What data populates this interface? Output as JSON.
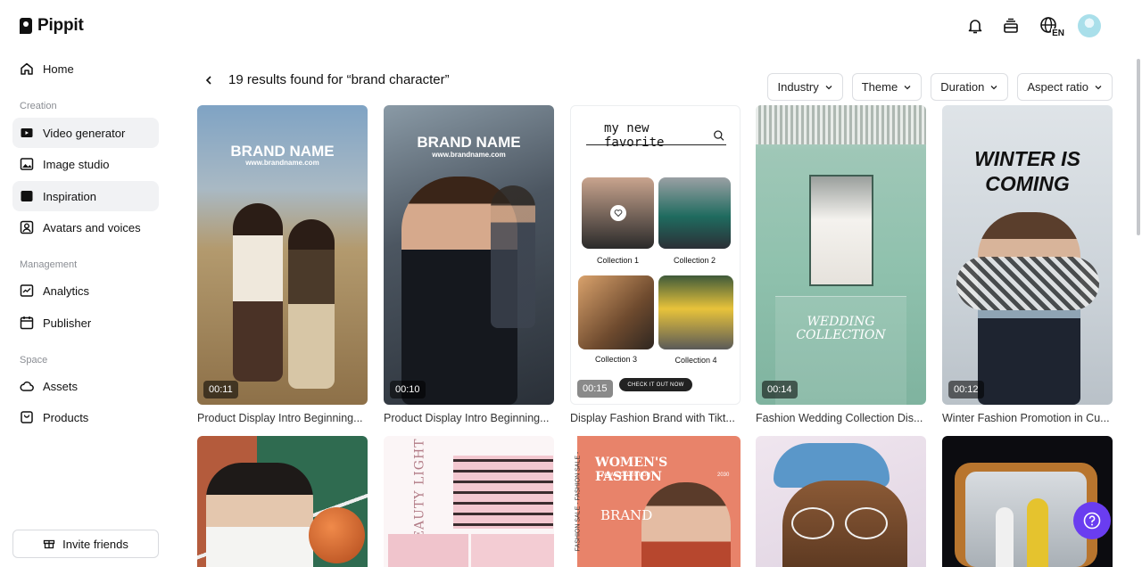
{
  "app": {
    "name": "Pippit"
  },
  "sidebar": {
    "home": "Home",
    "sections": {
      "creation": "Creation",
      "management": "Management",
      "space": "Space"
    },
    "items": {
      "video_generator": "Video generator",
      "image_studio": "Image studio",
      "inspiration": "Inspiration",
      "avatars": "Avatars and voices",
      "analytics": "Analytics",
      "publisher": "Publisher",
      "assets": "Assets",
      "products": "Products"
    },
    "invite": "Invite friends"
  },
  "header": {
    "language": "EN"
  },
  "results": {
    "title": "19 results found for “brand character”"
  },
  "filters": [
    "Industry",
    "Theme",
    "Duration",
    "Aspect ratio"
  ],
  "cards": [
    {
      "duration": "00:11",
      "caption": "Product Display Intro Beginning...",
      "overlay": "BRAND NAME",
      "sub": "www.brandname.com"
    },
    {
      "duration": "00:10",
      "caption": "Product Display Intro Beginning...",
      "overlay": "BRAND NAME",
      "sub": "www.brandname.com"
    },
    {
      "duration": "00:15",
      "caption": "Display Fashion Brand with Tikt...",
      "search": "my new favorite",
      "collections": [
        "Collection 1",
        "Collection 2",
        "Collection 3",
        "Collection 4"
      ],
      "cta": "CHECK IT OUT NOW"
    },
    {
      "duration": "00:14",
      "caption": "Fashion Wedding Collection Dis...",
      "overlay": "WEDDING COLLECTION"
    },
    {
      "duration": "00:12",
      "caption": "Winter Fashion Promotion in Cu...",
      "overlay": "WINTER IS COMING"
    }
  ],
  "row2": {
    "beauty": "BEAUTY LIGHT",
    "womens_title": "WOMEN'S FASHION",
    "womens_sub": "NEW COLLECTION",
    "womens_year": "2030",
    "womens_brand": "BRAND",
    "side_text": "FASHION SALE - FASHION SALE -"
  }
}
